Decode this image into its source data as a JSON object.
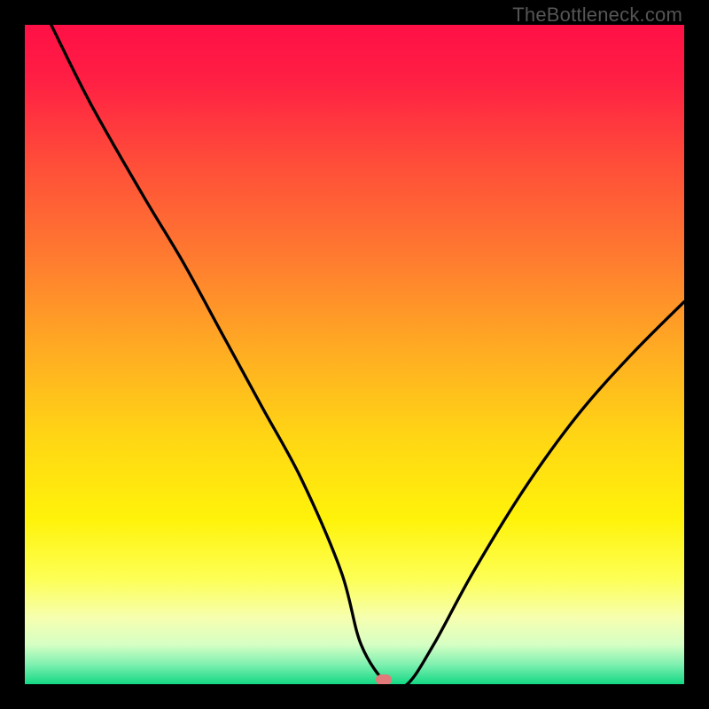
{
  "watermark": "TheBottleneck.com",
  "marker": {
    "color": "#e17a7a",
    "x_pct": 54.5,
    "y_pct": 99.3
  },
  "chart_data": {
    "type": "line",
    "title": "",
    "xlabel": "",
    "ylabel": "",
    "xlim": [
      0,
      100
    ],
    "ylim": [
      0,
      100
    ],
    "grid": false,
    "series": [
      {
        "name": "bottleneck-curve",
        "x": [
          4,
          10,
          18,
          24,
          30,
          36,
          42,
          48,
          51,
          55,
          58,
          62,
          68,
          76,
          84,
          92,
          100
        ],
        "y": [
          100,
          88,
          74,
          64,
          53,
          42,
          31,
          17,
          6,
          0,
          0,
          6,
          17,
          30,
          41,
          50,
          58
        ]
      }
    ],
    "gradient_stops": [
      {
        "offset": 0.0,
        "color": "#ff1046"
      },
      {
        "offset": 0.08,
        "color": "#ff1e44"
      },
      {
        "offset": 0.2,
        "color": "#ff4a3a"
      },
      {
        "offset": 0.35,
        "color": "#ff7a30"
      },
      {
        "offset": 0.5,
        "color": "#ffae22"
      },
      {
        "offset": 0.63,
        "color": "#ffd714"
      },
      {
        "offset": 0.75,
        "color": "#fff30a"
      },
      {
        "offset": 0.84,
        "color": "#fdff55"
      },
      {
        "offset": 0.9,
        "color": "#f6ffb0"
      },
      {
        "offset": 0.94,
        "color": "#d6ffc4"
      },
      {
        "offset": 0.97,
        "color": "#7ff0b0"
      },
      {
        "offset": 1.0,
        "color": "#14d884"
      }
    ]
  }
}
